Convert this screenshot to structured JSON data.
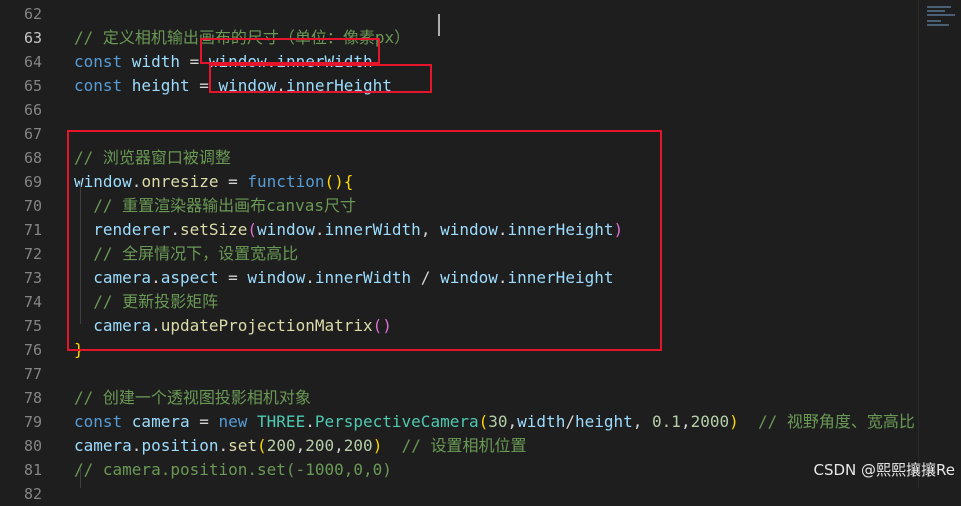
{
  "lines": [
    {
      "n": "62",
      "active": false,
      "tokens": []
    },
    {
      "n": "63",
      "active": true,
      "tokens": [
        {
          "c": "comment",
          "t": "// 定义相机输出画布的尺寸（单位：像素px）"
        }
      ]
    },
    {
      "n": "64",
      "active": false,
      "tokens": [
        {
          "c": "kw",
          "t": "const "
        },
        {
          "c": "var",
          "t": "width"
        },
        {
          "c": "plain",
          "t": " = "
        },
        {
          "c": "var",
          "t": "window"
        },
        {
          "c": "plain",
          "t": "."
        },
        {
          "c": "var",
          "t": "innerWidth"
        }
      ]
    },
    {
      "n": "65",
      "active": false,
      "tokens": [
        {
          "c": "kw",
          "t": "const "
        },
        {
          "c": "var",
          "t": "height"
        },
        {
          "c": "plain",
          "t": " = "
        },
        {
          "c": "var",
          "t": "window"
        },
        {
          "c": "plain",
          "t": "."
        },
        {
          "c": "var",
          "t": "innerHeight"
        }
      ]
    },
    {
      "n": "66",
      "active": false,
      "tokens": []
    },
    {
      "n": "67",
      "active": false,
      "tokens": []
    },
    {
      "n": "68",
      "active": false,
      "tokens": [
        {
          "c": "comment",
          "t": "// 浏览器窗口被调整"
        }
      ]
    },
    {
      "n": "69",
      "active": false,
      "tokens": [
        {
          "c": "var",
          "t": "window"
        },
        {
          "c": "plain",
          "t": "."
        },
        {
          "c": "fn",
          "t": "onresize"
        },
        {
          "c": "plain",
          "t": " = "
        },
        {
          "c": "kw",
          "t": "function"
        },
        {
          "c": "p1",
          "t": "(){"
        }
      ]
    },
    {
      "n": "70",
      "active": false,
      "tokens": [
        {
          "c": "plain",
          "t": "  "
        },
        {
          "c": "comment",
          "t": "// 重置渲染器输出画布canvas尺寸"
        }
      ]
    },
    {
      "n": "71",
      "active": false,
      "tokens": [
        {
          "c": "plain",
          "t": "  "
        },
        {
          "c": "var",
          "t": "renderer"
        },
        {
          "c": "plain",
          "t": "."
        },
        {
          "c": "fn",
          "t": "setSize"
        },
        {
          "c": "p2",
          "t": "("
        },
        {
          "c": "var",
          "t": "window"
        },
        {
          "c": "plain",
          "t": "."
        },
        {
          "c": "var",
          "t": "innerWidth"
        },
        {
          "c": "plain",
          "t": ", "
        },
        {
          "c": "var",
          "t": "window"
        },
        {
          "c": "plain",
          "t": "."
        },
        {
          "c": "var",
          "t": "innerHeight"
        },
        {
          "c": "p2",
          "t": ")"
        }
      ]
    },
    {
      "n": "72",
      "active": false,
      "tokens": [
        {
          "c": "plain",
          "t": "  "
        },
        {
          "c": "comment",
          "t": "// 全屏情况下，设置宽高比"
        }
      ]
    },
    {
      "n": "73",
      "active": false,
      "tokens": [
        {
          "c": "plain",
          "t": "  "
        },
        {
          "c": "var",
          "t": "camera"
        },
        {
          "c": "plain",
          "t": "."
        },
        {
          "c": "var",
          "t": "aspect"
        },
        {
          "c": "plain",
          "t": " = "
        },
        {
          "c": "var",
          "t": "window"
        },
        {
          "c": "plain",
          "t": "."
        },
        {
          "c": "var",
          "t": "innerWidth"
        },
        {
          "c": "plain",
          "t": " / "
        },
        {
          "c": "var",
          "t": "window"
        },
        {
          "c": "plain",
          "t": "."
        },
        {
          "c": "var",
          "t": "innerHeight"
        }
      ]
    },
    {
      "n": "74",
      "active": false,
      "tokens": [
        {
          "c": "plain",
          "t": "  "
        },
        {
          "c": "comment",
          "t": "// 更新投影矩阵"
        }
      ]
    },
    {
      "n": "75",
      "active": false,
      "tokens": [
        {
          "c": "plain",
          "t": "  "
        },
        {
          "c": "var",
          "t": "camera"
        },
        {
          "c": "plain",
          "t": "."
        },
        {
          "c": "fn",
          "t": "updateProjectionMatrix"
        },
        {
          "c": "p2",
          "t": "()"
        }
      ]
    },
    {
      "n": "76",
      "active": false,
      "tokens": [
        {
          "c": "p1",
          "t": "}"
        }
      ]
    },
    {
      "n": "77",
      "active": false,
      "tokens": []
    },
    {
      "n": "78",
      "active": false,
      "tokens": [
        {
          "c": "comment",
          "t": "// 创建一个透视图投影相机对象"
        }
      ]
    },
    {
      "n": "79",
      "active": false,
      "tokens": [
        {
          "c": "kw",
          "t": "const "
        },
        {
          "c": "var",
          "t": "camera"
        },
        {
          "c": "plain",
          "t": " = "
        },
        {
          "c": "kw",
          "t": "new "
        },
        {
          "c": "cls",
          "t": "THREE"
        },
        {
          "c": "plain",
          "t": "."
        },
        {
          "c": "cls",
          "t": "PerspectiveCamera"
        },
        {
          "c": "p1",
          "t": "("
        },
        {
          "c": "num",
          "t": "30"
        },
        {
          "c": "plain",
          "t": ","
        },
        {
          "c": "var",
          "t": "width"
        },
        {
          "c": "plain",
          "t": "/"
        },
        {
          "c": "var",
          "t": "height"
        },
        {
          "c": "plain",
          "t": ", "
        },
        {
          "c": "num",
          "t": "0.1"
        },
        {
          "c": "plain",
          "t": ","
        },
        {
          "c": "num",
          "t": "2000"
        },
        {
          "c": "p1",
          "t": ")"
        },
        {
          "c": "plain",
          "t": "  "
        },
        {
          "c": "comment",
          "t": "// 视野角度、宽高比"
        }
      ]
    },
    {
      "n": "80",
      "active": false,
      "tokens": [
        {
          "c": "var",
          "t": "camera"
        },
        {
          "c": "plain",
          "t": "."
        },
        {
          "c": "var",
          "t": "position"
        },
        {
          "c": "plain",
          "t": "."
        },
        {
          "c": "fn",
          "t": "set"
        },
        {
          "c": "p1",
          "t": "("
        },
        {
          "c": "num",
          "t": "200"
        },
        {
          "c": "plain",
          "t": ","
        },
        {
          "c": "num",
          "t": "200"
        },
        {
          "c": "plain",
          "t": ","
        },
        {
          "c": "num",
          "t": "200"
        },
        {
          "c": "p1",
          "t": ")"
        },
        {
          "c": "plain",
          "t": "  "
        },
        {
          "c": "comment",
          "t": "// 设置相机位置"
        }
      ]
    },
    {
      "n": "81",
      "active": false,
      "tokens": [
        {
          "c": "comment",
          "t": "// camera.position.set(-1000,0,0)"
        }
      ]
    },
    {
      "n": "82",
      "active": false,
      "tokens": []
    }
  ],
  "watermark": "CSDN @熙熙攘攘Re",
  "colors": {
    "background": "#1e1e1e",
    "comment": "#6a9955",
    "keyword": "#569cd6",
    "variable": "#9cdcfe",
    "function": "#dcdcaa",
    "number": "#b5cea8",
    "class": "#4ec9b0",
    "annotation_box": "#e5162c"
  }
}
